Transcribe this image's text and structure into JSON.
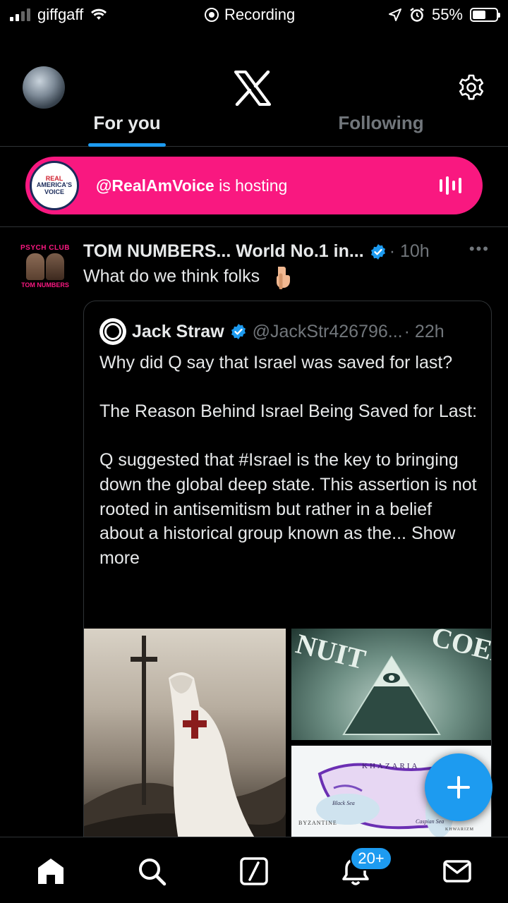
{
  "status_bar": {
    "carrier": "giffgaff",
    "center_label": "Recording",
    "battery": "55%",
    "battery_level": 0.55,
    "icons": [
      "signal-icon",
      "wifi-icon",
      "recording-icon",
      "location-icon",
      "alarm-icon",
      "battery-icon"
    ]
  },
  "header": {
    "logo": "x-logo",
    "tabs": [
      {
        "label": "For you",
        "active": true
      },
      {
        "label": "Following",
        "active": false
      }
    ]
  },
  "spaces": {
    "host": "@RealAmVoice",
    "suffix": " is hosting",
    "logo_text_top": "REAL",
    "logo_text_mid": "AMERICA'S",
    "logo_text_bottom": "VOICE",
    "color": "#f91880"
  },
  "tweet": {
    "avatar_text_top": "PSYCH CLUB",
    "avatar_text_bottom": "TOM NUMBERS",
    "name": "TOM NUMBERS... World No.1 in...",
    "time": "· 10h",
    "more": "•••",
    "text": "What do we think folks",
    "quote": {
      "name": "Jack Straw",
      "handle": "@JackStr426796...",
      "time": "· 22h",
      "body": "Why did Q say that Israel was saved for last?\n\nThe Reason Behind Israel Being Saved for Last:\n\nQ suggested that #Israel is the key to bringing down the global deep state. This assertion is not rooted in antisemitism but rather in a belief about a historical group known as the...",
      "show_more": " Show more",
      "media_labels": {
        "bill_left": "NUIT",
        "bill_right": "COEP",
        "map_title": "KHAZARIA",
        "map_sea1": "Black Sea",
        "map_sea2": "Caspian Sea",
        "map_region1": "BYZANTINE",
        "map_region2": "KHWARIZM"
      }
    }
  },
  "fab": {
    "label": "+"
  },
  "bottom_nav": {
    "items": [
      "home-icon",
      "search-icon",
      "grok-icon",
      "notifications-icon",
      "messages-icon"
    ],
    "badge": "20+"
  },
  "colors": {
    "accent": "#1d9bf0",
    "background": "#000000",
    "secondary_text": "#71767b",
    "spaces_pink": "#f91880"
  }
}
